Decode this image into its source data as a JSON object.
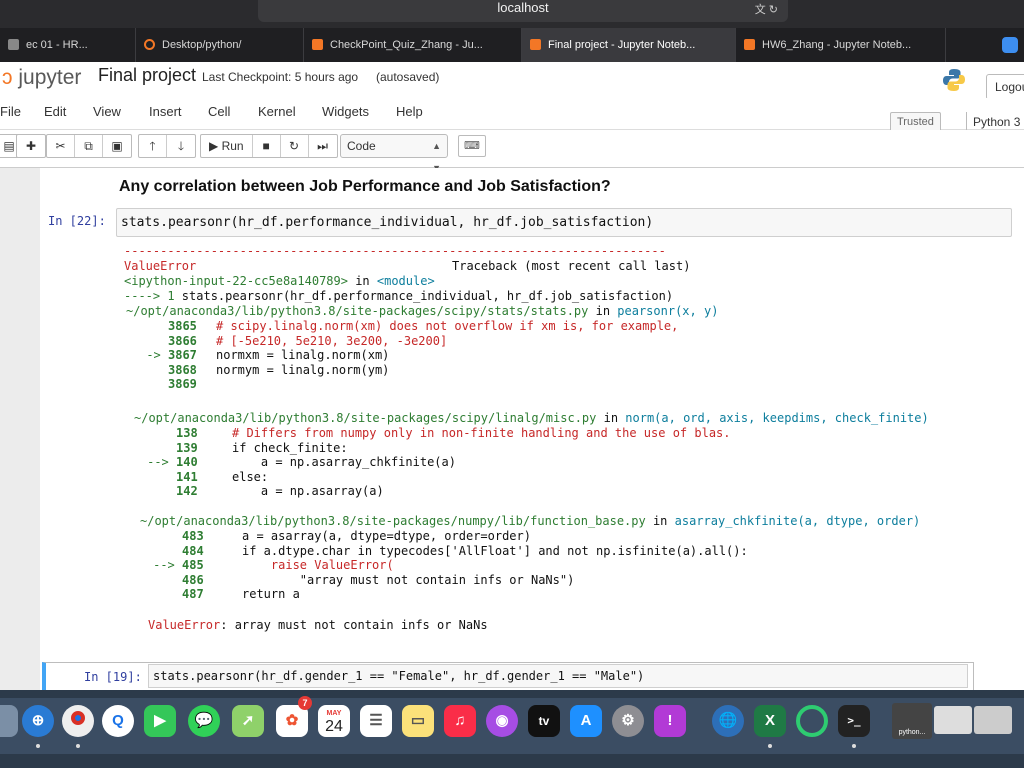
{
  "browser": {
    "url": "localhost",
    "tabs": [
      {
        "label": "ec 01 - HR..."
      },
      {
        "label": "Desktop/python/"
      },
      {
        "label": "CheckPoint_Quiz_Zhang - Ju..."
      },
      {
        "label": "Final project - Jupyter Noteb..."
      },
      {
        "label": "HW6_Zhang - Jupyter Noteb..."
      }
    ]
  },
  "header": {
    "logo": "jupyter",
    "notebook_name": "Final project",
    "checkpoint": "Last Checkpoint: 5 hours ago",
    "autosaved": "(autosaved)",
    "logout": "Logou"
  },
  "menu": {
    "items": [
      "File",
      "Edit",
      "View",
      "Insert",
      "Cell",
      "Kernel",
      "Widgets",
      "Help"
    ],
    "trusted": "Trusted",
    "kernel": "Python 3"
  },
  "toolbar": {
    "run_label": "Run",
    "cell_type": "Code"
  },
  "notebook": {
    "heading": "Any correlation between Job Performance and Job Satisfaction?",
    "cell_22": {
      "prompt": "In [22]:",
      "code": "stats.pearsonr(hr_df.performance_individual, hr_df.job_satisfaction)"
    },
    "traceback": {
      "rule": "---------------------------------------------------------------------------",
      "error_name": "ValueError",
      "header": "Traceback (most recent call last)",
      "input_ref": "<ipython-input-22-cc5e8a140789>",
      "in_word": " in ",
      "module": "<module>",
      "arrow_line": {
        "arrow": "----> 1 ",
        "code": "stats.pearsonr(hr_df.performance_individual, hr_df.job_satisfaction)"
      },
      "frames": [
        {
          "path": "~/opt/anaconda3/lib/python3.8/site-packages/scipy/stats/stats.py",
          "in_word": " in ",
          "func": "pearsonr(x, y)",
          "lines": [
            {
              "marker": "",
              "num": "3865",
              "code": "# scipy.linalg.norm(xm) does not overflow if xm is, for example,",
              "comment": true
            },
            {
              "marker": "",
              "num": "3866",
              "code": "# [-5e210, 5e210, 3e200, -3e200]",
              "comment": true
            },
            {
              "marker": "-> ",
              "num": "3867",
              "code": "normxm = linalg.norm(xm)",
              "comment": false
            },
            {
              "marker": "",
              "num": "3868",
              "code": "normym = linalg.norm(ym)",
              "comment": false
            },
            {
              "marker": "",
              "num": "3869",
              "code": "",
              "comment": false
            }
          ]
        },
        {
          "path": "~/opt/anaconda3/lib/python3.8/site-packages/scipy/linalg/misc.py",
          "in_word": " in ",
          "func": "norm(a, ord, axis, keepdims, check_finite)",
          "lines": [
            {
              "marker": "",
              "num": "138",
              "code": "# Differs from numpy only in non-finite handling and the use of blas.",
              "comment": true
            },
            {
              "marker": "",
              "num": "139",
              "code": "if check_finite:",
              "comment": false
            },
            {
              "marker": "--> ",
              "num": "140",
              "code": "    a = np.asarray_chkfinite(a)",
              "comment": false
            },
            {
              "marker": "",
              "num": "141",
              "code": "else:",
              "comment": false
            },
            {
              "marker": "",
              "num": "142",
              "code": "    a = np.asarray(a)",
              "comment": false
            }
          ]
        },
        {
          "path": "~/opt/anaconda3/lib/python3.8/site-packages/numpy/lib/function_base.py",
          "in_word": " in ",
          "func": "asarray_chkfinite(a, dtype, order)",
          "lines": [
            {
              "marker": "",
              "num": "483",
              "code": "a = asarray(a, dtype=dtype, order=order)",
              "comment": false
            },
            {
              "marker": "",
              "num": "484",
              "code": "if a.dtype.char in typecodes['AllFloat'] and not np.isfinite(a).all():",
              "comment": false
            },
            {
              "marker": "--> ",
              "num": "485",
              "code": "    raise ValueError(",
              "comment": true
            },
            {
              "marker": "",
              "num": "486",
              "code": "        \"array must not contain infs or NaNs\")",
              "comment": false
            },
            {
              "marker": "",
              "num": "487",
              "code": "return a",
              "comment": false
            }
          ]
        }
      ],
      "final_error_name": "ValueError",
      "final_message": ": array must not contain infs or NaNs"
    },
    "cell_19": {
      "prompt": "In [19]:",
      "code": "stats.pearsonr(hr_df.gender_1 == \"Female\", hr_df.gender_1 == \"Male\")"
    }
  },
  "dock": {
    "calendar_month": "MAY",
    "calendar_day": "24",
    "photos_badge": "7",
    "tv_label": "tv",
    "thumbnail_label": "python..."
  }
}
